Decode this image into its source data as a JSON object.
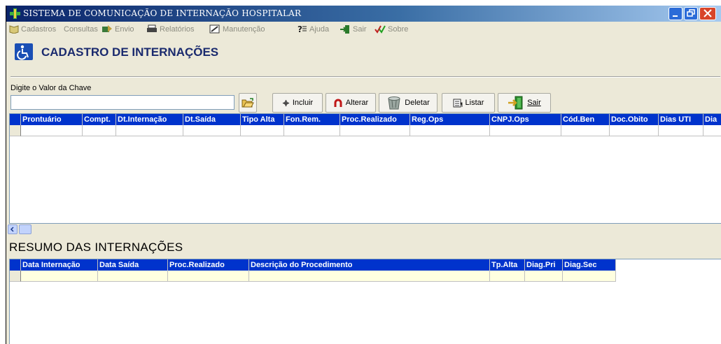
{
  "window": {
    "title": "SISTEMA DE COMUNICAÇÃO DE INTERNAÇÃO HOSPITALAR"
  },
  "menu": {
    "items": [
      {
        "label": "Cadastros",
        "icon": "book-icon"
      },
      {
        "label": "Consultas",
        "icon": ""
      },
      {
        "label": "Envio",
        "icon": "send-icon"
      },
      {
        "label": "Relatórios",
        "icon": "printer-icon"
      },
      {
        "label": "Manutenção",
        "icon": "tools-icon"
      },
      {
        "label": "Ajuda",
        "icon": "help-icon"
      },
      {
        "label": "Sair",
        "icon": "exit-icon"
      },
      {
        "label": "Sobre",
        "icon": "check-icon"
      }
    ]
  },
  "header": {
    "title": "CADASTRO DE INTERNAÇÕES",
    "icon": "wheelchair-icon"
  },
  "search": {
    "label": "Digite o Valor da Chave",
    "value": ""
  },
  "toolbar": {
    "incluir": "Incluir",
    "alterar": "Alterar",
    "deletar": "Deletar",
    "listar": "Listar",
    "sair": "Sair"
  },
  "main_grid": {
    "columns": [
      "Prontuário",
      "Compt.",
      "Dt.Internação",
      "Dt.Saída",
      "Tipo Alta",
      "Fon.Rem.",
      "Proc.Realizado",
      "Reg.Ops",
      "CNPJ.Ops",
      "Cód.Ben",
      "Doc.Obito",
      "Dias UTI",
      "Dia"
    ]
  },
  "summary": {
    "title": "RESUMO DAS INTERNAÇÕES",
    "columns": [
      "Data Internação",
      "Data Saída",
      "Proc.Realizado",
      "Descrição do Procedimento",
      "Tp.Alta",
      "Diag.Pri",
      "Diag.Sec"
    ]
  },
  "colors": {
    "grid_header": "#0033cc",
    "title_text": "#1a2a6e",
    "summary_row": "#ffffe0"
  }
}
